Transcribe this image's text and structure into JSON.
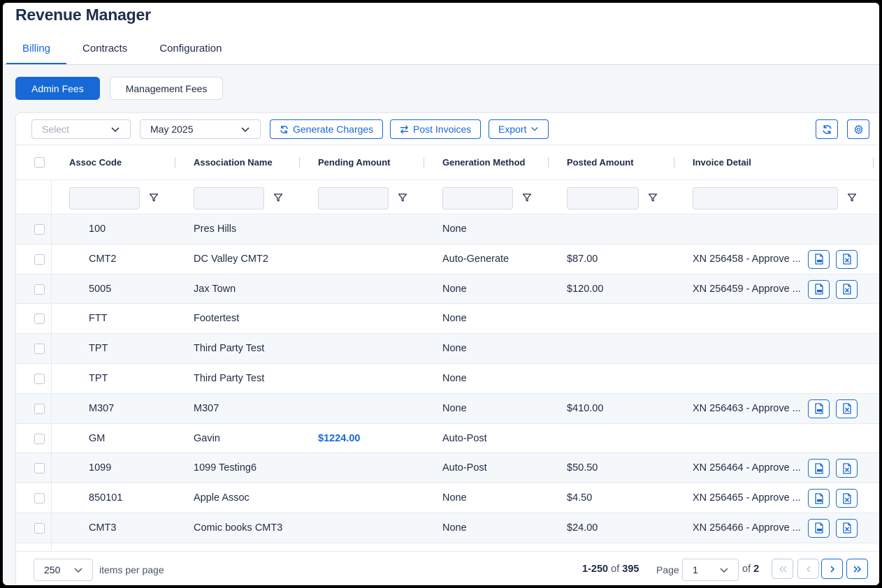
{
  "app": {
    "title": "Revenue Manager"
  },
  "tabs": [
    {
      "label": "Billing",
      "active": true
    },
    {
      "label": "Contracts",
      "active": false
    },
    {
      "label": "Configuration",
      "active": false
    }
  ],
  "subtabs": [
    {
      "label": "Admin Fees",
      "active": true
    },
    {
      "label": "Management Fees",
      "active": false
    }
  ],
  "toolbar": {
    "select_placeholder": "Select",
    "month_value": "May 2025",
    "generate_label": "Generate Charges",
    "post_label": "Post Invoices",
    "export_label": "Export"
  },
  "columns": [
    "Assoc Code",
    "Association Name",
    "Pending Amount",
    "Generation Method",
    "Posted Amount",
    "Invoice Detail"
  ],
  "rows": [
    {
      "code": "100",
      "name": "Pres Hills",
      "pending": "",
      "method": "None",
      "posted": "",
      "invoice": ""
    },
    {
      "code": "CMT2",
      "name": "DC Valley CMT2",
      "pending": "",
      "method": "Auto-Generate",
      "posted": "$87.00",
      "invoice": "XN 256458 - Approve ..."
    },
    {
      "code": "5005",
      "name": "Jax Town",
      "pending": "",
      "method": "None",
      "posted": "$120.00",
      "invoice": "XN 256459 - Approve ..."
    },
    {
      "code": "FTT",
      "name": "Footertest",
      "pending": "",
      "method": "None",
      "posted": "",
      "invoice": ""
    },
    {
      "code": "TPT",
      "name": "Third Party Test",
      "pending": "",
      "method": "None",
      "posted": "",
      "invoice": ""
    },
    {
      "code": "TPT",
      "name": "Third Party Test",
      "pending": "",
      "method": "None",
      "posted": "",
      "invoice": ""
    },
    {
      "code": "M307",
      "name": "M307",
      "pending": "",
      "method": "None",
      "posted": "$410.00",
      "invoice": "XN 256463 - Approve ..."
    },
    {
      "code": "GM",
      "name": "Gavin",
      "pending": "$1224.00",
      "method": "Auto-Post",
      "posted": "",
      "invoice": ""
    },
    {
      "code": "1099",
      "name": "1099 Testing6",
      "pending": "",
      "method": "Auto-Post",
      "posted": "$50.50",
      "invoice": "XN 256464 - Approve ..."
    },
    {
      "code": "850101",
      "name": "Apple Assoc",
      "pending": "",
      "method": "None",
      "posted": "$4.50",
      "invoice": "XN 256465 - Approve ..."
    },
    {
      "code": "CMT3",
      "name": "Comic books CMT3",
      "pending": "",
      "method": "None",
      "posted": "$24.00",
      "invoice": "XN 256466 - Approve ..."
    }
  ],
  "footer": {
    "per_page_value": "250",
    "per_page_label": "items per page",
    "range": "1-250",
    "of_word": "of",
    "total": "395",
    "page_label": "Page",
    "page_value": "1",
    "page_of": "of",
    "page_total": "2"
  },
  "colors": {
    "accent": "#1669d6",
    "text": "#1f2a44"
  }
}
